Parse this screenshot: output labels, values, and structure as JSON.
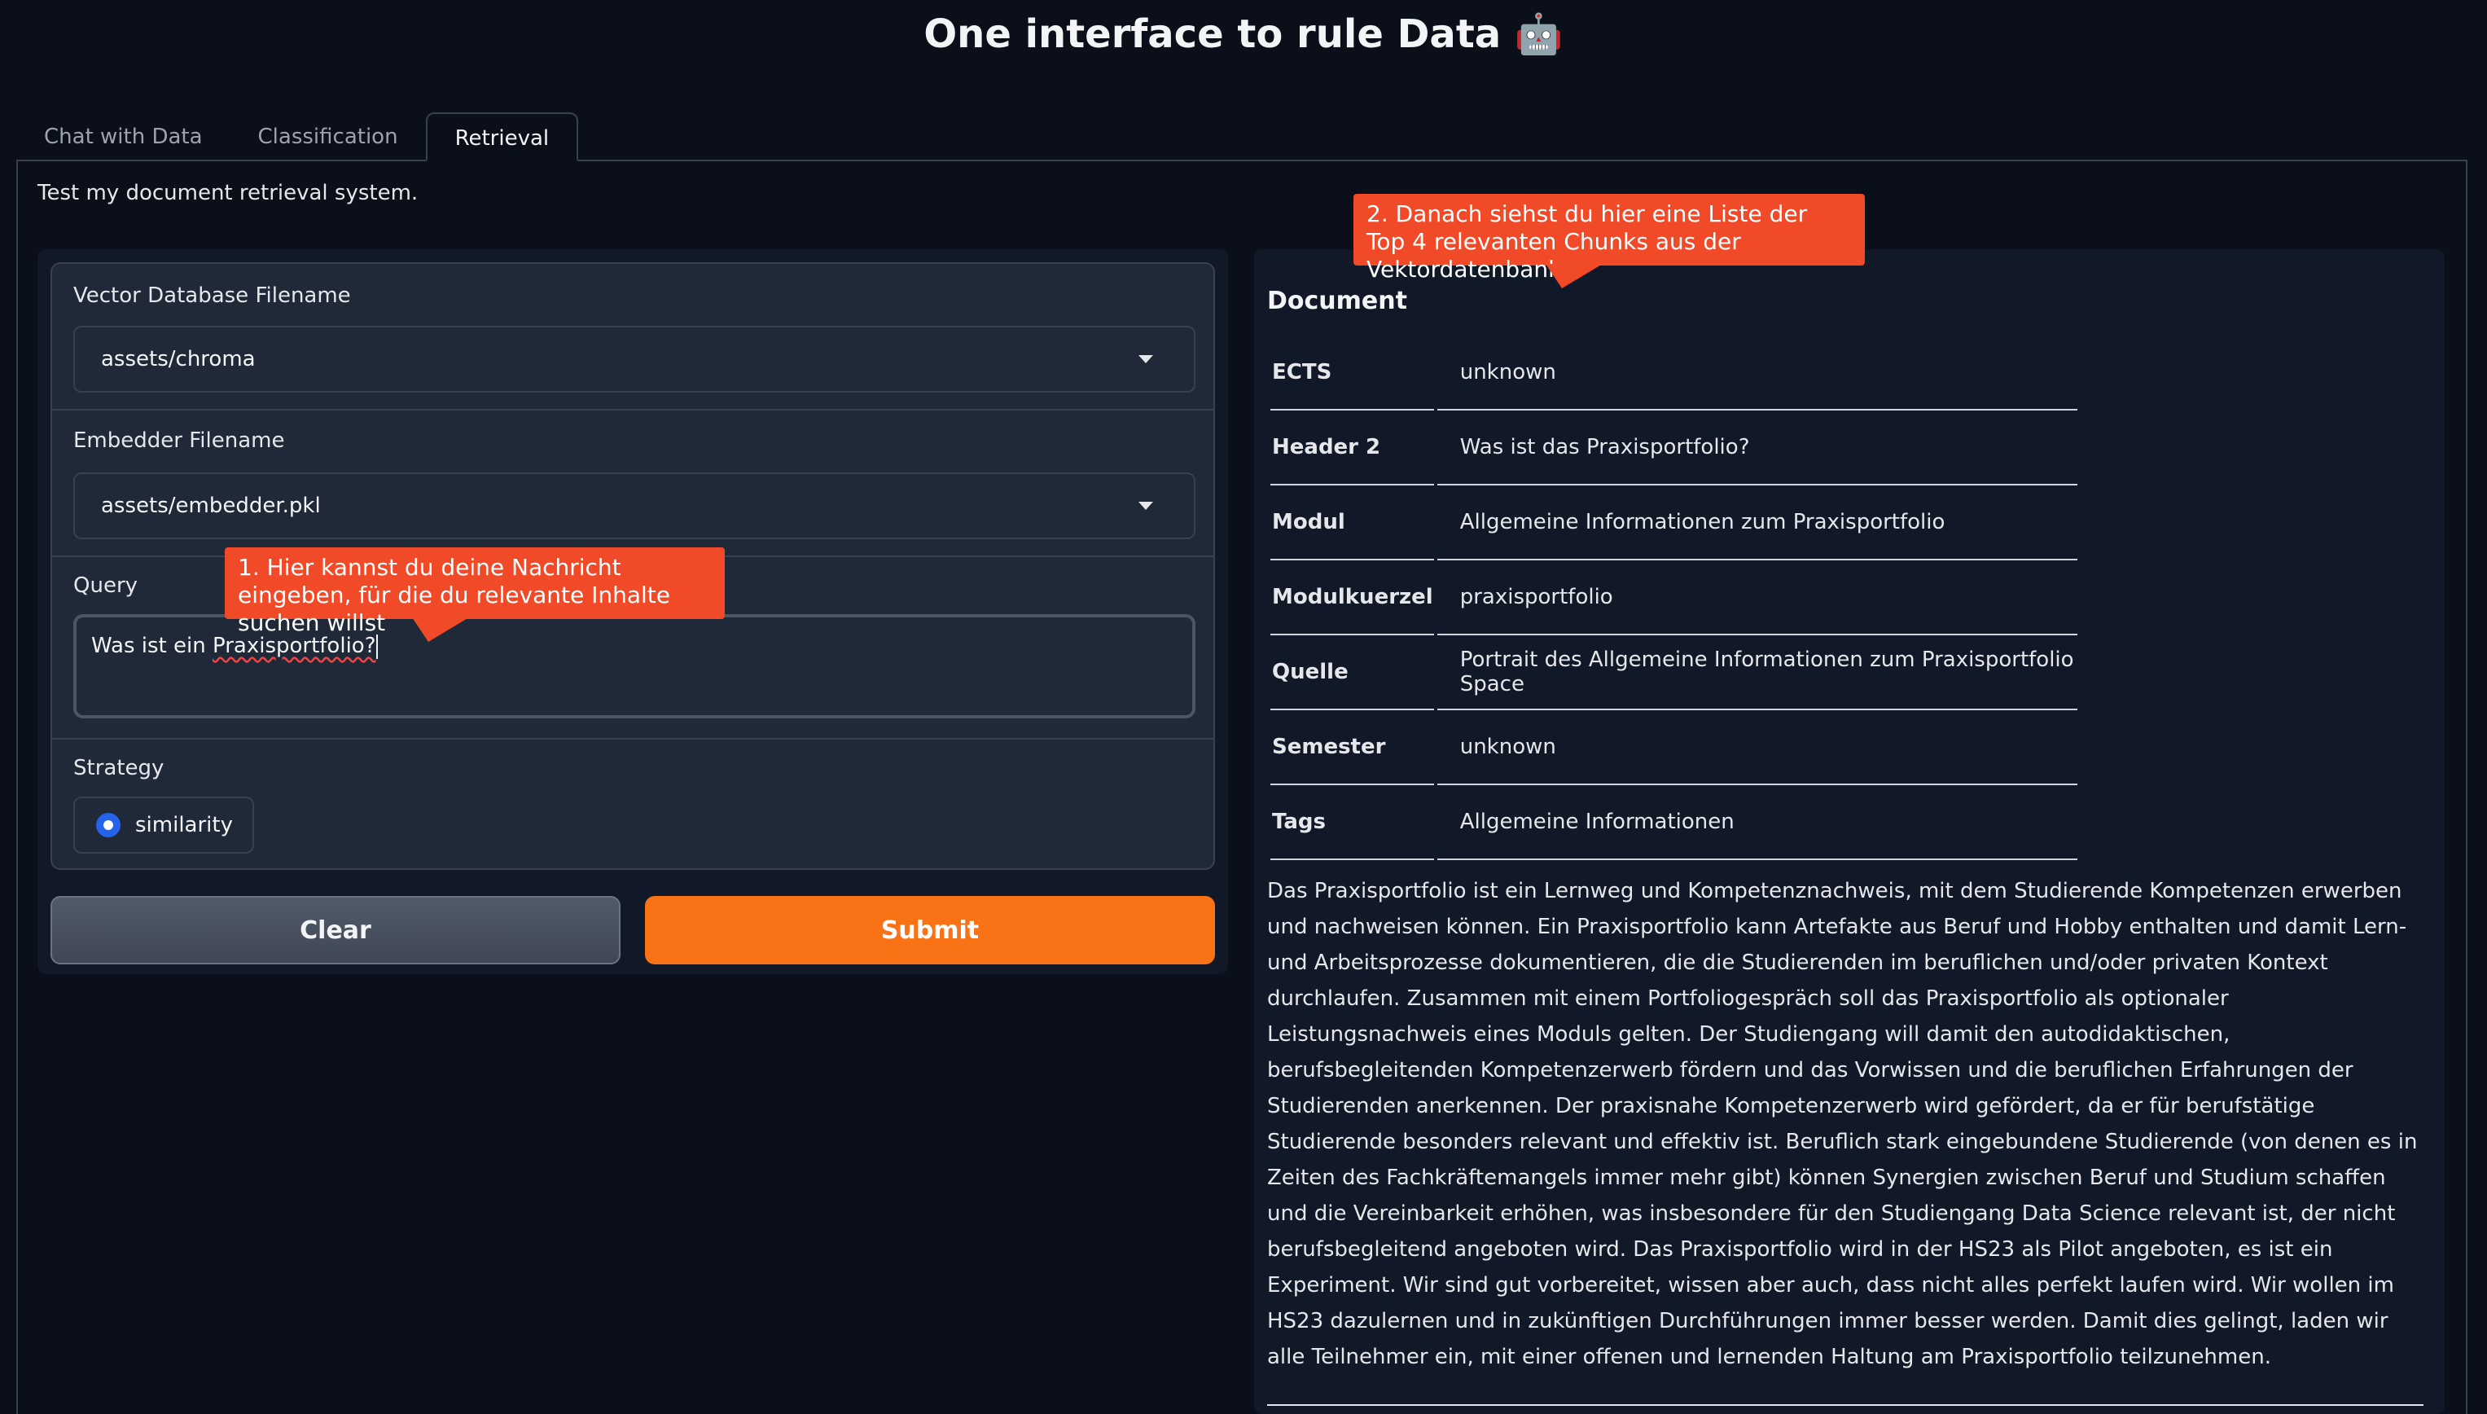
{
  "app": {
    "title": "One interface to rule Data 🤖"
  },
  "tabs": [
    {
      "label": "Chat with Data",
      "active": false
    },
    {
      "label": "Classification",
      "active": false
    },
    {
      "label": "Retrieval",
      "active": true
    }
  ],
  "retrieval": {
    "description": "Test my document retrieval system.",
    "vector_db": {
      "label": "Vector Database Filename",
      "value": "assets/chroma"
    },
    "embedder": {
      "label": "Embedder Filename",
      "value": "assets/embedder.pkl"
    },
    "query": {
      "label": "Query",
      "value_prefix": "Was ist ein ",
      "value_misspelled": "Praxisportfolio?"
    },
    "strategy": {
      "label": "Strategy",
      "options": [
        "similarity"
      ],
      "selected": "similarity"
    },
    "buttons": {
      "clear": "Clear",
      "submit": "Submit"
    }
  },
  "callouts": {
    "one": "1. Hier kannst du deine Nachricht eingeben, für die du relevante Inhalte suchen willst",
    "two": "2. Danach siehst du hier eine Liste der Top 4 relevanten Chunks aus der Vektordatenbank"
  },
  "document": {
    "title": "Document",
    "metadata": [
      {
        "key": "ECTS",
        "value": "unknown"
      },
      {
        "key": "Header 2",
        "value": "Was ist das Praxisportfolio?"
      },
      {
        "key": "Modul",
        "value": "Allgemeine Informationen zum Praxisportfolio"
      },
      {
        "key": "Modulkuerzel",
        "value": "praxisportfolio"
      },
      {
        "key": "Quelle",
        "value": "Portrait des Allgemeine Informationen zum Praxisportfolio Space"
      },
      {
        "key": "Semester",
        "value": "unknown"
      },
      {
        "key": "Tags",
        "value": "Allgemeine Informationen"
      }
    ],
    "body": "Das Praxisportfolio ist ein Lernweg und Kompetenznachweis, mit dem Studierende Kompetenzen erwerben und nachweisen können. Ein Praxisportfolio kann Artefakte aus Beruf und Hobby enthalten und damit Lern- und Arbeitsprozesse dokumentieren, die die Studierenden im beruflichen und/oder privaten Kontext durchlaufen. Zusammen mit einem Portfoliogespräch soll das Praxisportfolio als optionaler Leistungsnachweis eines Moduls gelten. Der Studiengang will damit den autodidaktischen, berufsbegleitenden Kompetenzerwerb fördern und das Vorwissen und die beruflichen Erfahrungen der Studierenden anerkennen. Der praxisnahe Kompetenzerwerb wird gefördert, da er für berufstätige Studierende besonders relevant und effektiv ist. Beruflich stark eingebundene Studierende (von denen es in Zeiten des Fachkräftemangels immer mehr gibt) können Synergien zwischen Beruf und Studium schaffen und die Vereinbarkeit erhöhen, was insbesondere für den Studiengang Data Science relevant ist, der nicht berufsbegleitend angeboten wird. Das Praxisportfolio wird in der HS23 als Pilot angeboten, es ist ein Experiment. Wir sind gut vorbereitet, wissen aber auch, dass nicht alles perfekt laufen wird. Wir wollen im HS23 dazulernen und in zukünftigen Durchführungen immer besser werden. Damit dies gelingt, laden wir alle Teilnehmer ein, mit einer offenen und lernenden Haltung am Praxisportfolio teilzunehmen."
  }
}
